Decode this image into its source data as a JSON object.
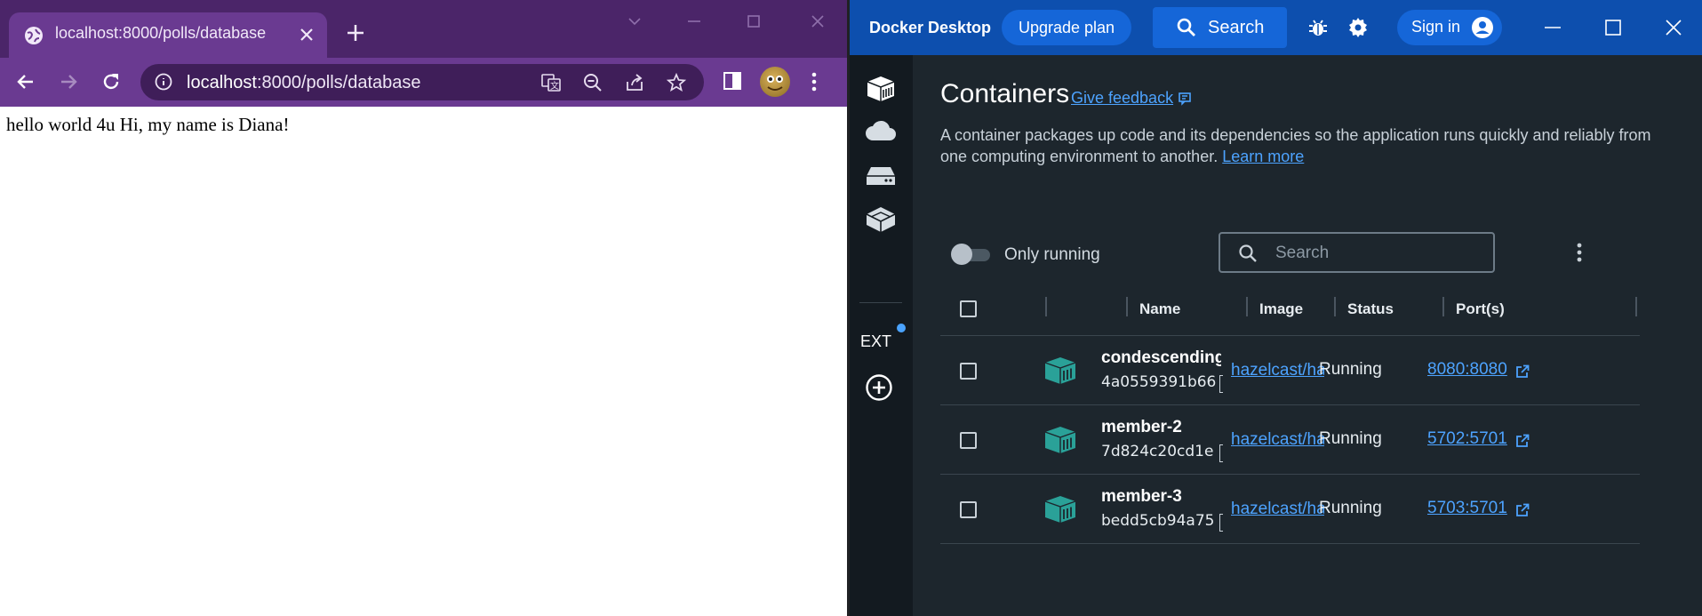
{
  "browser": {
    "tab_title": "localhost:8000/polls/database",
    "url_host": "localhost",
    "url_rest": ":8000/polls/database",
    "page_text": "hello world 4u Hi, my name is Diana!"
  },
  "docker": {
    "app_name": "Docker Desktop",
    "upgrade_label": "Upgrade plan",
    "search_label": "Search",
    "signin_label": "Sign in",
    "sidebar_ext_label": "EXT",
    "title": "Containers",
    "feedback_label": "Give feedback",
    "description": "A container packages up code and its dependencies so the application runs quickly and reliably from one computing environment to another.",
    "learn_more": "Learn more",
    "only_running_label": "Only running",
    "search_placeholder": "Search",
    "columns": {
      "name": "Name",
      "image": "Image",
      "status": "Status",
      "ports": "Port(s)"
    },
    "containers": [
      {
        "name": "condescending",
        "id": "4a0559391b66",
        "image": "hazelcast/hazelcast",
        "status": "Running",
        "port": "8080:8080"
      },
      {
        "name": "member-2",
        "id": "7d824c20cd1e",
        "image": "hazelcast/hazelcast",
        "status": "Running",
        "port": "5702:5701"
      },
      {
        "name": "member-3",
        "id": "bedd5cb94a75",
        "image": "hazelcast/hazelcast",
        "status": "Running",
        "port": "5703:5701"
      }
    ],
    "accent_color": "#0d4fae",
    "link_color": "#4da3ff",
    "container_icon_color": "#2aa198"
  }
}
